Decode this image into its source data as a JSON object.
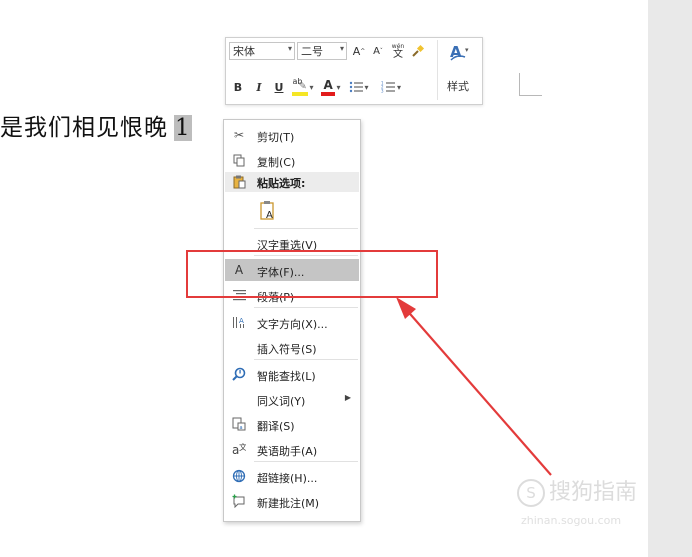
{
  "document": {
    "text": "是我们相见恨晚",
    "selected_text": "1"
  },
  "mini_toolbar": {
    "font_name": "宋体",
    "font_size": "二号",
    "grow_font": "A",
    "shrink_font": "A",
    "phonetic_top": "wén",
    "phonetic_char": "文",
    "bold": "B",
    "italic": "I",
    "underline": "U",
    "highlight": "ab",
    "font_color": "A",
    "styles_label": "样式"
  },
  "context_menu": {
    "items": [
      {
        "label": "剪切(T)",
        "icon": "scissors-icon"
      },
      {
        "label": "复制(C)",
        "icon": "copy-icon"
      },
      {
        "label": "粘贴选项:",
        "icon": "paste-icon"
      },
      {
        "label": "",
        "icon": "paste-text-only-icon"
      },
      {
        "label": "汉字重选(V)",
        "icon": ""
      },
      {
        "label": "字体(F)...",
        "icon": "font-icon"
      },
      {
        "label": "段落(P)",
        "icon": "paragraph-icon"
      },
      {
        "label": "文字方向(X)...",
        "icon": "text-direction-icon"
      },
      {
        "label": "插入符号(S)",
        "icon": ""
      },
      {
        "label": "智能查找(L)",
        "icon": "smart-lookup-icon"
      },
      {
        "label": "同义词(Y)",
        "icon": ""
      },
      {
        "label": "翻译(S)",
        "icon": "translate-icon"
      },
      {
        "label": "英语助手(A)",
        "icon": "english-assistant-icon"
      },
      {
        "label": "超链接(H)...",
        "icon": "hyperlink-icon"
      },
      {
        "label": "新建批注(M)",
        "icon": "new-comment-icon"
      }
    ]
  },
  "watermark": {
    "line1": "搜狗指南",
    "line2": "zhinan.sogou.com",
    "logo_letter": "S"
  },
  "colors": {
    "annotation_red": "#e33b3b",
    "highlight_yellow": "#f5e625",
    "font_color_red": "#e21b1b",
    "menu_hover": "#c5c5c5"
  }
}
